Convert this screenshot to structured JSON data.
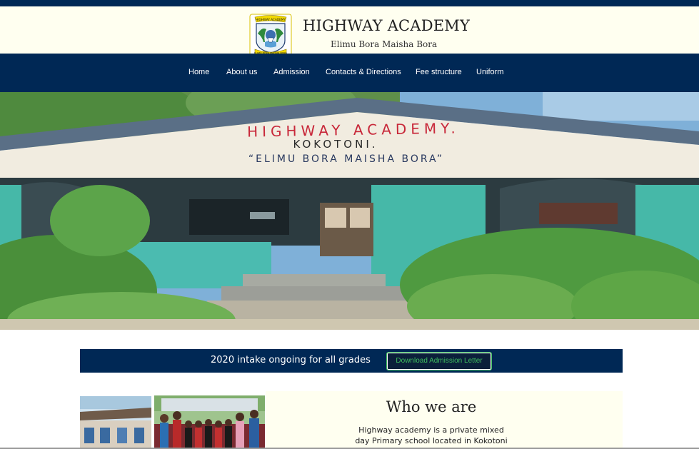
{
  "site": {
    "title": "HIGHWAY ACADEMY",
    "tagline": "Elimu Bora Maisha Bora"
  },
  "logo": {
    "top_text": "HIGHWAY ACADEMY",
    "bottom_text": "ELIMU BORA MAISHA BORA"
  },
  "nav": {
    "items": [
      {
        "label": "Home"
      },
      {
        "label": "About us"
      },
      {
        "label": "Admission"
      },
      {
        "label": "Contacts & Directions"
      },
      {
        "label": "Fee structure"
      },
      {
        "label": "Uniform"
      }
    ]
  },
  "hero": {
    "building_sign_line1": "HIGHWAY ACADEMY.",
    "building_sign_line2": "KOKOTONI.",
    "building_sign_line3": "“ELIMU BORA MAISHA BORA”"
  },
  "intake": {
    "text": "2020 intake ongoing for all grades",
    "button_label": "Download Admission Letter"
  },
  "about": {
    "title": "Who we are",
    "body_line1": "Highway academy is a private mixed",
    "body_line2": "day Primary school located in Kokotoni"
  },
  "colors": {
    "navy": "#002855",
    "cream": "#fffff0",
    "button_green": "#3fbf5f",
    "wall_teal": "#46b8a8",
    "sign_red": "#c8283a"
  }
}
